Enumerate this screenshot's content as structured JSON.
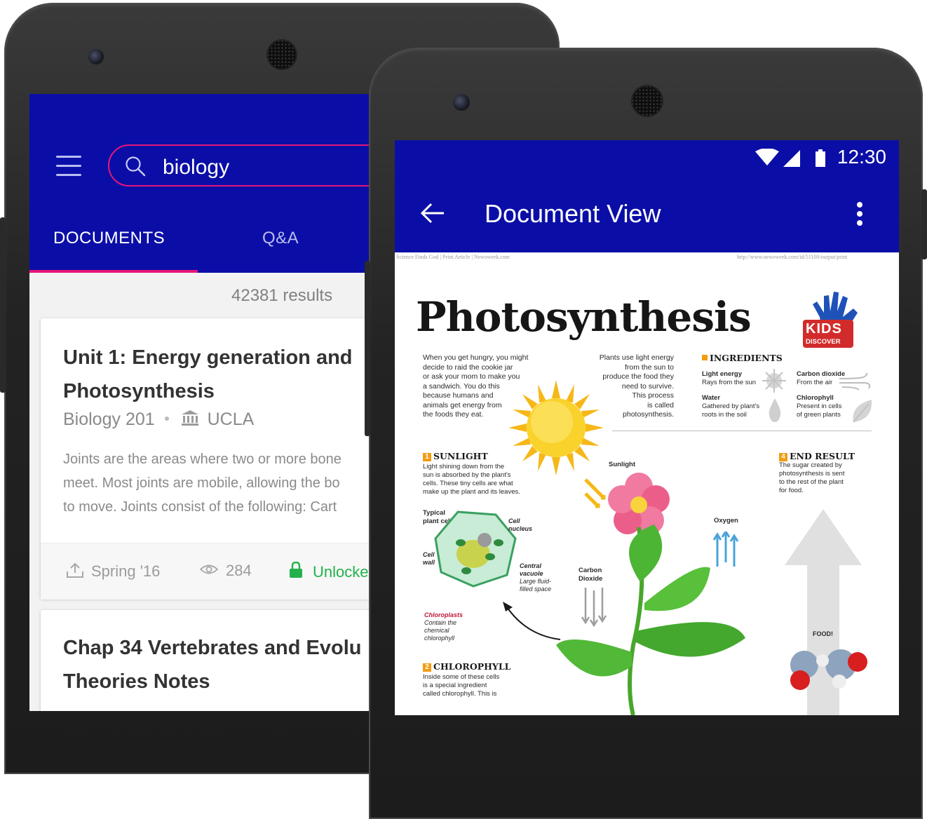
{
  "search_screen": {
    "query": "biology",
    "tabs": [
      {
        "label": "DOCUMENTS",
        "active": true
      },
      {
        "label": "Q&A",
        "active": false
      }
    ],
    "results_count": "42381 results",
    "documents": [
      {
        "title_line1": "Unit 1: Energy generation and",
        "title_line2": "Photosynthesis",
        "course": "Biology 201",
        "school": "UCLA",
        "excerpt_lines": [
          "Joints are the areas where two or more bone",
          "meet. Most joints are mobile, allowing the bo",
          "to move. Joints consist of the following: Cart"
        ],
        "term": "Spring '16",
        "views": "284",
        "status": "Unlocke"
      },
      {
        "title_line1": "Chap 34 Vertebrates and Evolu",
        "title_line2": "Theories Notes"
      }
    ]
  },
  "document_screen": {
    "status_time": "12:30",
    "title": "Document View",
    "doc": {
      "header_left": "Science Finds God | Print Article | Newsweek.com",
      "header_right": "http://www.newsweek.com/id/51100/output/print",
      "title": "Photosynthesis",
      "logo_line1": "KIDS",
      "logo_line2": "DISCOVER",
      "intro_left": [
        "When you get hungry, you might",
        "decide to raid the cookie jar",
        "or ask your mom to make you",
        "a sandwich. You do this",
        "because humans and",
        "animals get energy from",
        "the foods they eat."
      ],
      "intro_right": [
        "Plants use light energy",
        "from the sun to",
        "produce the food they",
        "need to survive.",
        "This process",
        "is called",
        "photosynthesis."
      ],
      "ingredients_heading": "INGREDIENTS",
      "ingredients": [
        {
          "name": "Light energy",
          "desc": "Rays from the sun"
        },
        {
          "name": "Carbon dioxide",
          "desc": "From the air"
        },
        {
          "name": "Water",
          "desc_lines": [
            "Gathered by plant's",
            "roots in the soil"
          ]
        },
        {
          "name": "Chlorophyll",
          "desc_lines": [
            "Present in cells",
            "of green plants"
          ]
        }
      ],
      "sunlight": {
        "num": "1",
        "heading": "SUNLIGHT",
        "lines": [
          "Light shining down from the",
          "sun is absorbed by the plant's",
          "cells. These tiny cells are what",
          "make up the plant and its leaves."
        ]
      },
      "end_result": {
        "num": "4",
        "heading": "END RESULT",
        "lines": [
          "The sugar created by",
          "photosynthesis is sent",
          "to the rest of the plant",
          "for food."
        ]
      },
      "chlorophyll": {
        "num": "2",
        "heading": "CHLOROPHYLL",
        "lines": [
          "Inside some of these cells",
          "is a special ingredient",
          "called chlorophyll. This is"
        ]
      },
      "labels": {
        "sunlight": "Sunlight",
        "oxygen": "Oxygen",
        "carbon_dioxide": [
          "Carbon",
          "Dioxide"
        ],
        "typical_cell": [
          "Typical",
          "plant cell"
        ],
        "cell_nucleus": [
          "Cell",
          "nucleus"
        ],
        "cell_wall": [
          "Cell",
          "wall"
        ],
        "vacuole": [
          "Central",
          "vacuole",
          "Large fluid-",
          "filled space"
        ],
        "chloroplasts": [
          "Chloroplasts",
          "Contain the",
          "chemical",
          "chlorophyll"
        ],
        "food": "FOOD!"
      }
    }
  },
  "colors": {
    "app_bar": "#0b0ea6",
    "accent": "#e6157a",
    "unlocked": "#22b14c"
  }
}
